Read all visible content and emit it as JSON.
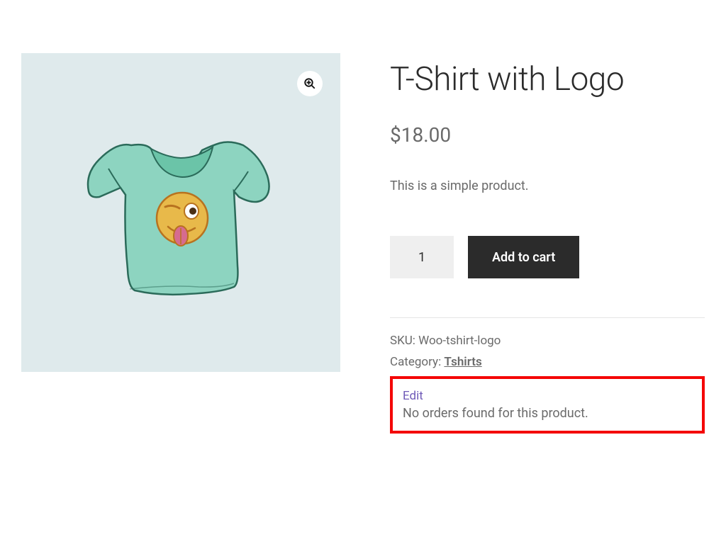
{
  "product": {
    "title": "T-Shirt with Logo",
    "price": "$18.00",
    "description": "This is a simple product.",
    "quantity": "1",
    "add_to_cart_label": "Add to cart"
  },
  "meta": {
    "sku_label": "SKU: ",
    "sku_value": "Woo-tshirt-logo",
    "category_label": "Category: ",
    "category_value": "Tshirts",
    "edit_label": "Edit",
    "orders_note": "No orders found for this product."
  },
  "icons": {
    "zoom": "zoom-in"
  }
}
